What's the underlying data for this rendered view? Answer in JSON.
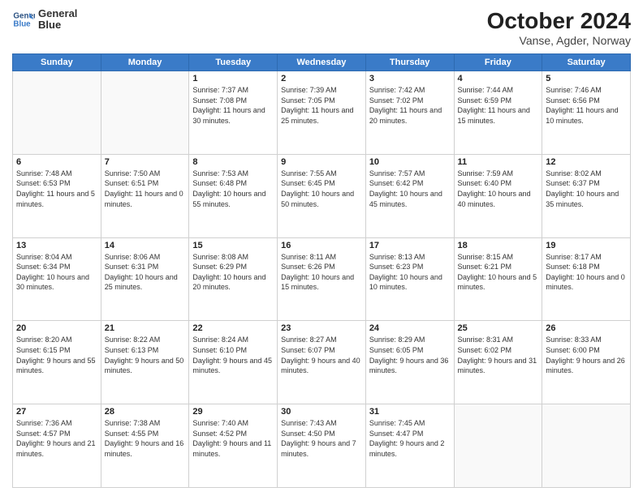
{
  "header": {
    "logo_line1": "General",
    "logo_line2": "Blue",
    "title": "October 2024",
    "subtitle": "Vanse, Agder, Norway"
  },
  "weekdays": [
    "Sunday",
    "Monday",
    "Tuesday",
    "Wednesday",
    "Thursday",
    "Friday",
    "Saturday"
  ],
  "weeks": [
    [
      {
        "day": "",
        "sunrise": "",
        "sunset": "",
        "daylight": ""
      },
      {
        "day": "",
        "sunrise": "",
        "sunset": "",
        "daylight": ""
      },
      {
        "day": "1",
        "sunrise": "Sunrise: 7:37 AM",
        "sunset": "Sunset: 7:08 PM",
        "daylight": "Daylight: 11 hours and 30 minutes."
      },
      {
        "day": "2",
        "sunrise": "Sunrise: 7:39 AM",
        "sunset": "Sunset: 7:05 PM",
        "daylight": "Daylight: 11 hours and 25 minutes."
      },
      {
        "day": "3",
        "sunrise": "Sunrise: 7:42 AM",
        "sunset": "Sunset: 7:02 PM",
        "daylight": "Daylight: 11 hours and 20 minutes."
      },
      {
        "day": "4",
        "sunrise": "Sunrise: 7:44 AM",
        "sunset": "Sunset: 6:59 PM",
        "daylight": "Daylight: 11 hours and 15 minutes."
      },
      {
        "day": "5",
        "sunrise": "Sunrise: 7:46 AM",
        "sunset": "Sunset: 6:56 PM",
        "daylight": "Daylight: 11 hours and 10 minutes."
      }
    ],
    [
      {
        "day": "6",
        "sunrise": "Sunrise: 7:48 AM",
        "sunset": "Sunset: 6:53 PM",
        "daylight": "Daylight: 11 hours and 5 minutes."
      },
      {
        "day": "7",
        "sunrise": "Sunrise: 7:50 AM",
        "sunset": "Sunset: 6:51 PM",
        "daylight": "Daylight: 11 hours and 0 minutes."
      },
      {
        "day": "8",
        "sunrise": "Sunrise: 7:53 AM",
        "sunset": "Sunset: 6:48 PM",
        "daylight": "Daylight: 10 hours and 55 minutes."
      },
      {
        "day": "9",
        "sunrise": "Sunrise: 7:55 AM",
        "sunset": "Sunset: 6:45 PM",
        "daylight": "Daylight: 10 hours and 50 minutes."
      },
      {
        "day": "10",
        "sunrise": "Sunrise: 7:57 AM",
        "sunset": "Sunset: 6:42 PM",
        "daylight": "Daylight: 10 hours and 45 minutes."
      },
      {
        "day": "11",
        "sunrise": "Sunrise: 7:59 AM",
        "sunset": "Sunset: 6:40 PM",
        "daylight": "Daylight: 10 hours and 40 minutes."
      },
      {
        "day": "12",
        "sunrise": "Sunrise: 8:02 AM",
        "sunset": "Sunset: 6:37 PM",
        "daylight": "Daylight: 10 hours and 35 minutes."
      }
    ],
    [
      {
        "day": "13",
        "sunrise": "Sunrise: 8:04 AM",
        "sunset": "Sunset: 6:34 PM",
        "daylight": "Daylight: 10 hours and 30 minutes."
      },
      {
        "day": "14",
        "sunrise": "Sunrise: 8:06 AM",
        "sunset": "Sunset: 6:31 PM",
        "daylight": "Daylight: 10 hours and 25 minutes."
      },
      {
        "day": "15",
        "sunrise": "Sunrise: 8:08 AM",
        "sunset": "Sunset: 6:29 PM",
        "daylight": "Daylight: 10 hours and 20 minutes."
      },
      {
        "day": "16",
        "sunrise": "Sunrise: 8:11 AM",
        "sunset": "Sunset: 6:26 PM",
        "daylight": "Daylight: 10 hours and 15 minutes."
      },
      {
        "day": "17",
        "sunrise": "Sunrise: 8:13 AM",
        "sunset": "Sunset: 6:23 PM",
        "daylight": "Daylight: 10 hours and 10 minutes."
      },
      {
        "day": "18",
        "sunrise": "Sunrise: 8:15 AM",
        "sunset": "Sunset: 6:21 PM",
        "daylight": "Daylight: 10 hours and 5 minutes."
      },
      {
        "day": "19",
        "sunrise": "Sunrise: 8:17 AM",
        "sunset": "Sunset: 6:18 PM",
        "daylight": "Daylight: 10 hours and 0 minutes."
      }
    ],
    [
      {
        "day": "20",
        "sunrise": "Sunrise: 8:20 AM",
        "sunset": "Sunset: 6:15 PM",
        "daylight": "Daylight: 9 hours and 55 minutes."
      },
      {
        "day": "21",
        "sunrise": "Sunrise: 8:22 AM",
        "sunset": "Sunset: 6:13 PM",
        "daylight": "Daylight: 9 hours and 50 minutes."
      },
      {
        "day": "22",
        "sunrise": "Sunrise: 8:24 AM",
        "sunset": "Sunset: 6:10 PM",
        "daylight": "Daylight: 9 hours and 45 minutes."
      },
      {
        "day": "23",
        "sunrise": "Sunrise: 8:27 AM",
        "sunset": "Sunset: 6:07 PM",
        "daylight": "Daylight: 9 hours and 40 minutes."
      },
      {
        "day": "24",
        "sunrise": "Sunrise: 8:29 AM",
        "sunset": "Sunset: 6:05 PM",
        "daylight": "Daylight: 9 hours and 36 minutes."
      },
      {
        "day": "25",
        "sunrise": "Sunrise: 8:31 AM",
        "sunset": "Sunset: 6:02 PM",
        "daylight": "Daylight: 9 hours and 31 minutes."
      },
      {
        "day": "26",
        "sunrise": "Sunrise: 8:33 AM",
        "sunset": "Sunset: 6:00 PM",
        "daylight": "Daylight: 9 hours and 26 minutes."
      }
    ],
    [
      {
        "day": "27",
        "sunrise": "Sunrise: 7:36 AM",
        "sunset": "Sunset: 4:57 PM",
        "daylight": "Daylight: 9 hours and 21 minutes."
      },
      {
        "day": "28",
        "sunrise": "Sunrise: 7:38 AM",
        "sunset": "Sunset: 4:55 PM",
        "daylight": "Daylight: 9 hours and 16 minutes."
      },
      {
        "day": "29",
        "sunrise": "Sunrise: 7:40 AM",
        "sunset": "Sunset: 4:52 PM",
        "daylight": "Daylight: 9 hours and 11 minutes."
      },
      {
        "day": "30",
        "sunrise": "Sunrise: 7:43 AM",
        "sunset": "Sunset: 4:50 PM",
        "daylight": "Daylight: 9 hours and 7 minutes."
      },
      {
        "day": "31",
        "sunrise": "Sunrise: 7:45 AM",
        "sunset": "Sunset: 4:47 PM",
        "daylight": "Daylight: 9 hours and 2 minutes."
      },
      {
        "day": "",
        "sunrise": "",
        "sunset": "",
        "daylight": ""
      },
      {
        "day": "",
        "sunrise": "",
        "sunset": "",
        "daylight": ""
      }
    ]
  ]
}
